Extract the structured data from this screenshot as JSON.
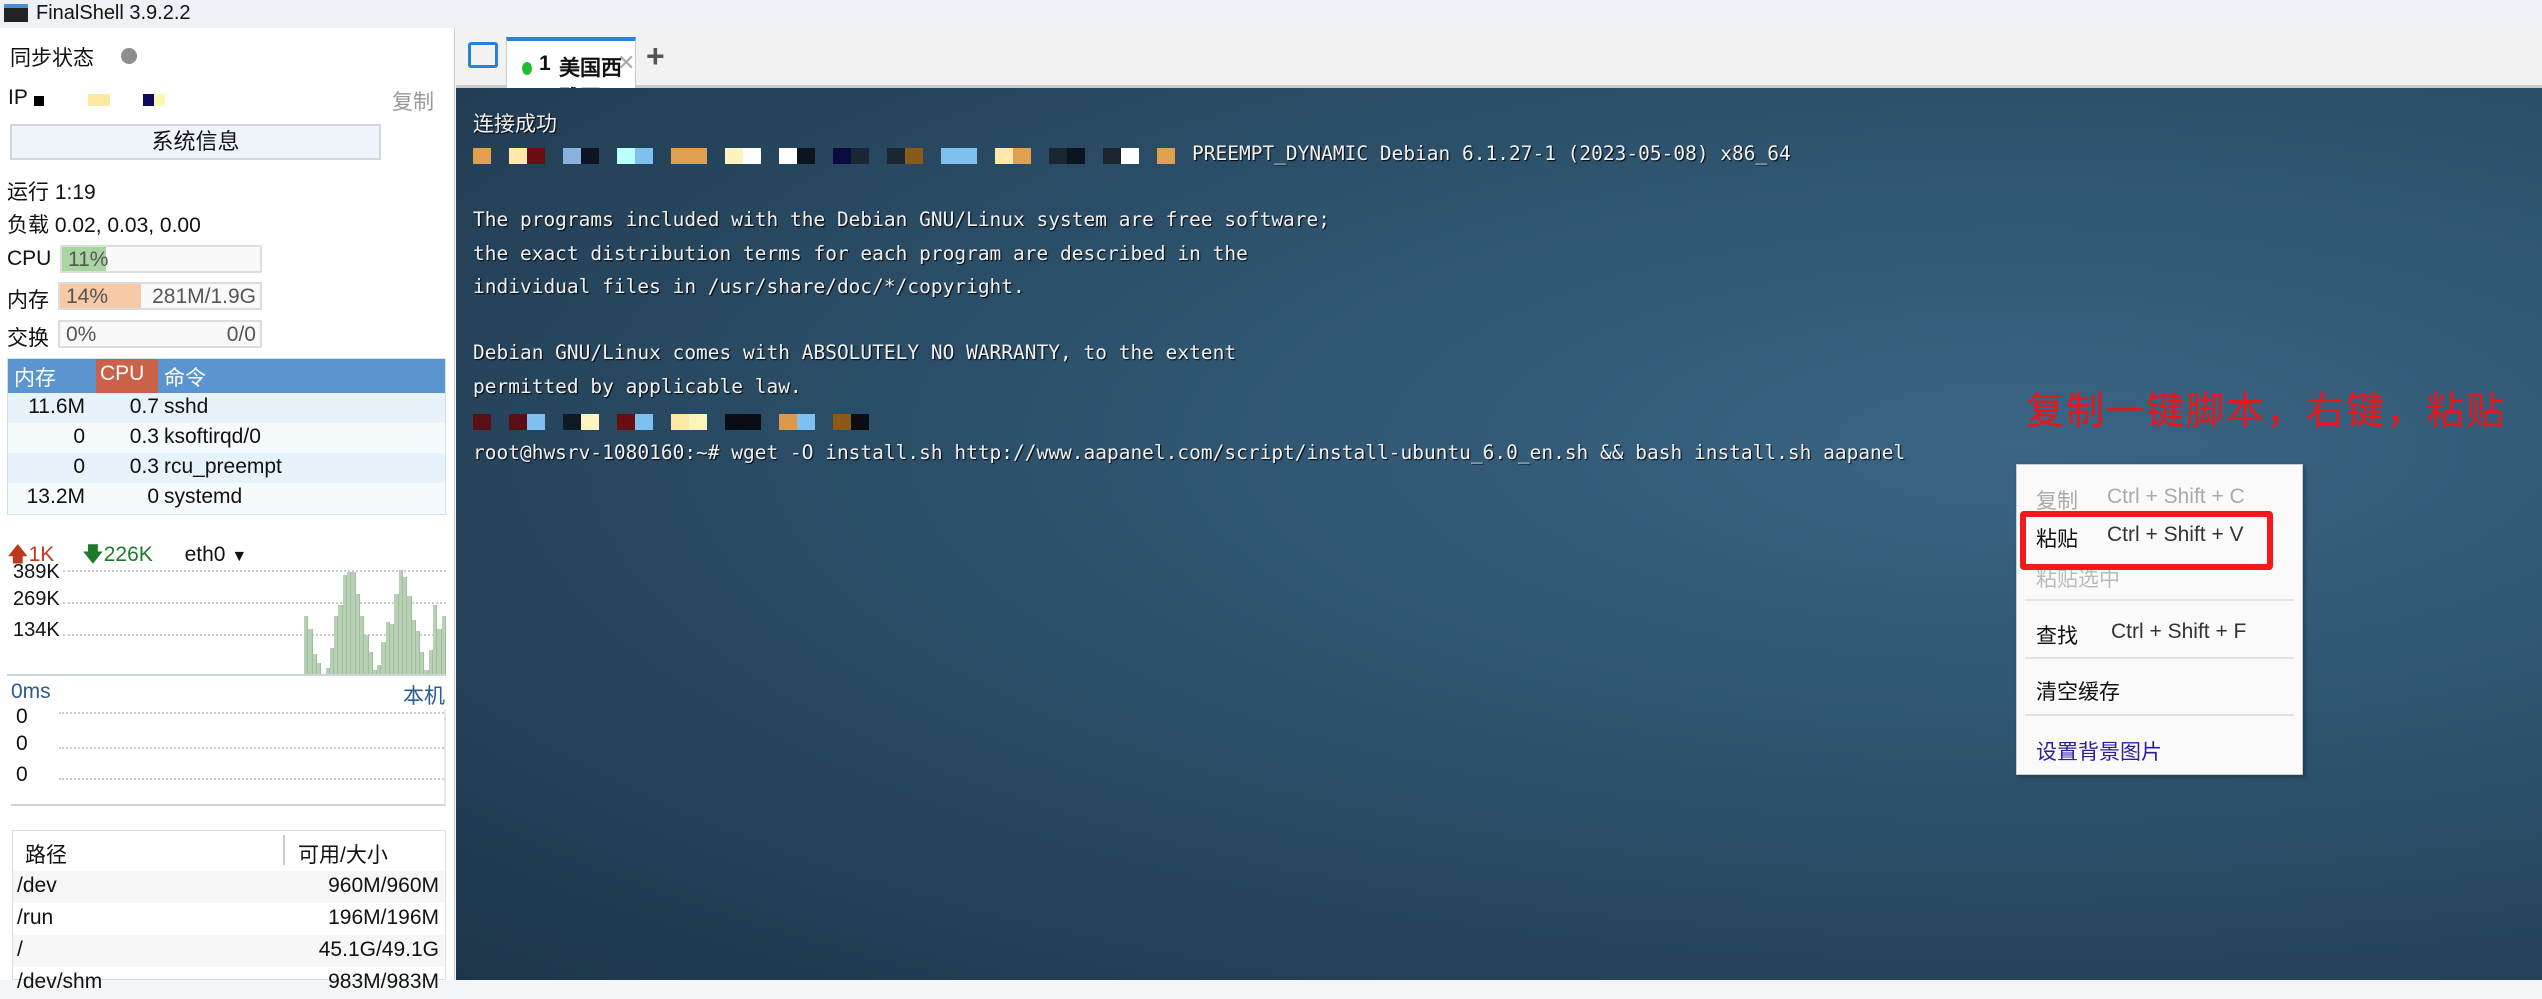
{
  "app": {
    "title": "FinalShell 3.9.2.2"
  },
  "sidebar": {
    "sync_label": "同步状态",
    "ip_label": "IP",
    "copy_label": "复制",
    "sysinfo_button": "系统信息",
    "uptime": "运行 1:19",
    "load": "负载 0.02, 0.03, 0.00",
    "cpu": {
      "label": "CPU",
      "percent": 11,
      "text": "11%",
      "color": "#a8d5a2"
    },
    "mem": {
      "label": "内存",
      "percent": 14,
      "text": "14%",
      "amount": "281M/1.9G",
      "color": "#f8c9a6"
    },
    "swap": {
      "label": "交换",
      "percent": 0,
      "text": "0%",
      "amount": "0/0"
    },
    "process_table": {
      "headers": [
        "内存",
        "CPU",
        "命令"
      ],
      "rows": [
        [
          "11.6M",
          "0.7",
          "sshd"
        ],
        [
          "0",
          "0.3",
          "ksoftirqd/0"
        ],
        [
          "0",
          "0.3",
          "rcu_preempt"
        ],
        [
          "13.2M",
          "0",
          "systemd"
        ]
      ]
    },
    "network": {
      "up": "1K",
      "down": "226K",
      "interface": "eth0",
      "ticks": [
        "389K",
        "269K",
        "134K"
      ],
      "bars_k": [
        218,
        169,
        77,
        42,
        0,
        21,
        98,
        218,
        260,
        372,
        386,
        386,
        302,
        218,
        147,
        84,
        14,
        35,
        119,
        197,
        190,
        302,
        393,
        365,
        295,
        204,
        161,
        84,
        14,
        91,
        260,
        169,
        218
      ],
      "max_k": 400,
      "bar_color": "#b6d1b4"
    },
    "ping": {
      "latency": "0ms",
      "host": "本机",
      "ticks": [
        "0",
        "0",
        "0"
      ]
    },
    "disk_table": {
      "headers": [
        "路径",
        "可用/大小"
      ],
      "rows": [
        [
          "/dev",
          "960M/960M"
        ],
        [
          "/run",
          "196M/196M"
        ],
        [
          "/",
          "45.1G/49.1G"
        ],
        [
          "/dev/shm",
          "983M/983M"
        ]
      ]
    }
  },
  "tabs": [
    {
      "index": "1",
      "label": "美国西雅图",
      "status_color": "#22bb33"
    }
  ],
  "terminal": {
    "lines": [
      "连接成功",
      "PREEMPT_DYNAMIC Debian 6.1.27-1 (2023-05-08) x86_64",
      "The programs included with the Debian GNU/Linux system are free software;",
      "the exact distribution terms for each program are described in the",
      "individual files in /usr/share/doc/*/copyright.",
      "Debian GNU/Linux comes with ABSOLUTELY NO WARRANTY, to the extent",
      "permitted by applicable law.",
      "root@hwsrv-1080160:~# wget -O install.sh http://www.aapanel.com/script/install-ubuntu_6.0_en.sh && bash install.sh aapanel"
    ],
    "mosaic_colors": [
      "#0b1420",
      "#d99a4e",
      "#1a2633",
      "#8a5a1a",
      "#bff",
      "#fff3c0",
      "#5a0f14",
      "#0a0d14",
      "#7ec0f0",
      "#0f1a24",
      "#ffe8a8",
      "#e0a050",
      "#1b2530",
      "#8ab0e0",
      "#fff",
      "#0a0a40",
      "#6a0d10"
    ]
  },
  "annotation": "复制一键脚本，右键，粘贴",
  "context_menu": {
    "items": [
      {
        "label": "复制",
        "shortcut": "Ctrl + Shift + C",
        "enabled": false
      },
      {
        "label": "粘贴",
        "shortcut": "Ctrl + Shift + V",
        "enabled": true,
        "highlighted": true
      },
      {
        "label": "粘贴选中",
        "shortcut": "",
        "enabled": false
      },
      {
        "label": "查找",
        "shortcut": "Ctrl + Shift + F",
        "enabled": true
      },
      {
        "label": "清空缓存",
        "shortcut": "",
        "enabled": true
      },
      {
        "label": "设置背景图片",
        "shortcut": "",
        "enabled": true,
        "color": "#2a1fa0"
      }
    ]
  }
}
